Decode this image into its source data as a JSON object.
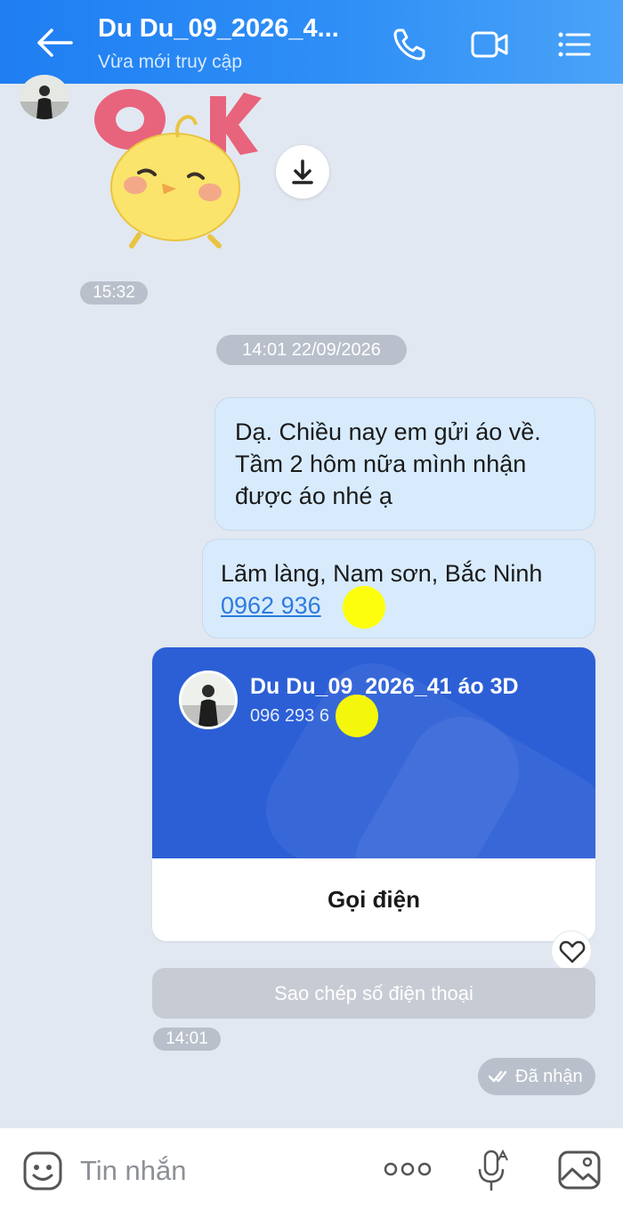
{
  "header": {
    "title": "Du Du_09_2026_4...",
    "subtitle": "Vừa mới truy cập",
    "icons": {
      "back": "arrow-left-icon",
      "call": "phone-icon",
      "video": "video-camera-icon",
      "menu": "menu-list-icon"
    }
  },
  "messages": {
    "sticker_text": "OK",
    "time_1": "15:32",
    "date_separator": "14:01 22/09/2026",
    "bubble_1_text": "Dạ. Chiều nay em gửi áo về. Tầm 2 hôm nữa mình nhận được áo nhé ạ",
    "bubble_2_text": "Lãm làng, Nam sơn, Bắc Ninh",
    "bubble_2_phone": "0962 936 ",
    "time_2": "14:01"
  },
  "contact_card": {
    "name": "Du Du_09_2026_41 áo 3D",
    "phone": "096 293 6",
    "call_label": "Gọi điện",
    "copy_label": "Sao chép số điện thoại"
  },
  "status": {
    "received_label": "Đã nhận"
  },
  "composer": {
    "placeholder": "Tin nhắn",
    "icons": {
      "emoji": "emoji-icon",
      "more": "more-icon",
      "mic": "microphone-icon",
      "image": "image-icon"
    }
  },
  "colors": {
    "header_start": "#1f7ef2",
    "header_end": "#4aa3f8",
    "chat_background": "#e2e8f1",
    "bubble": "#d7ebfc",
    "card_blue": "#2c5fd6",
    "link": "#2f7ae0"
  }
}
